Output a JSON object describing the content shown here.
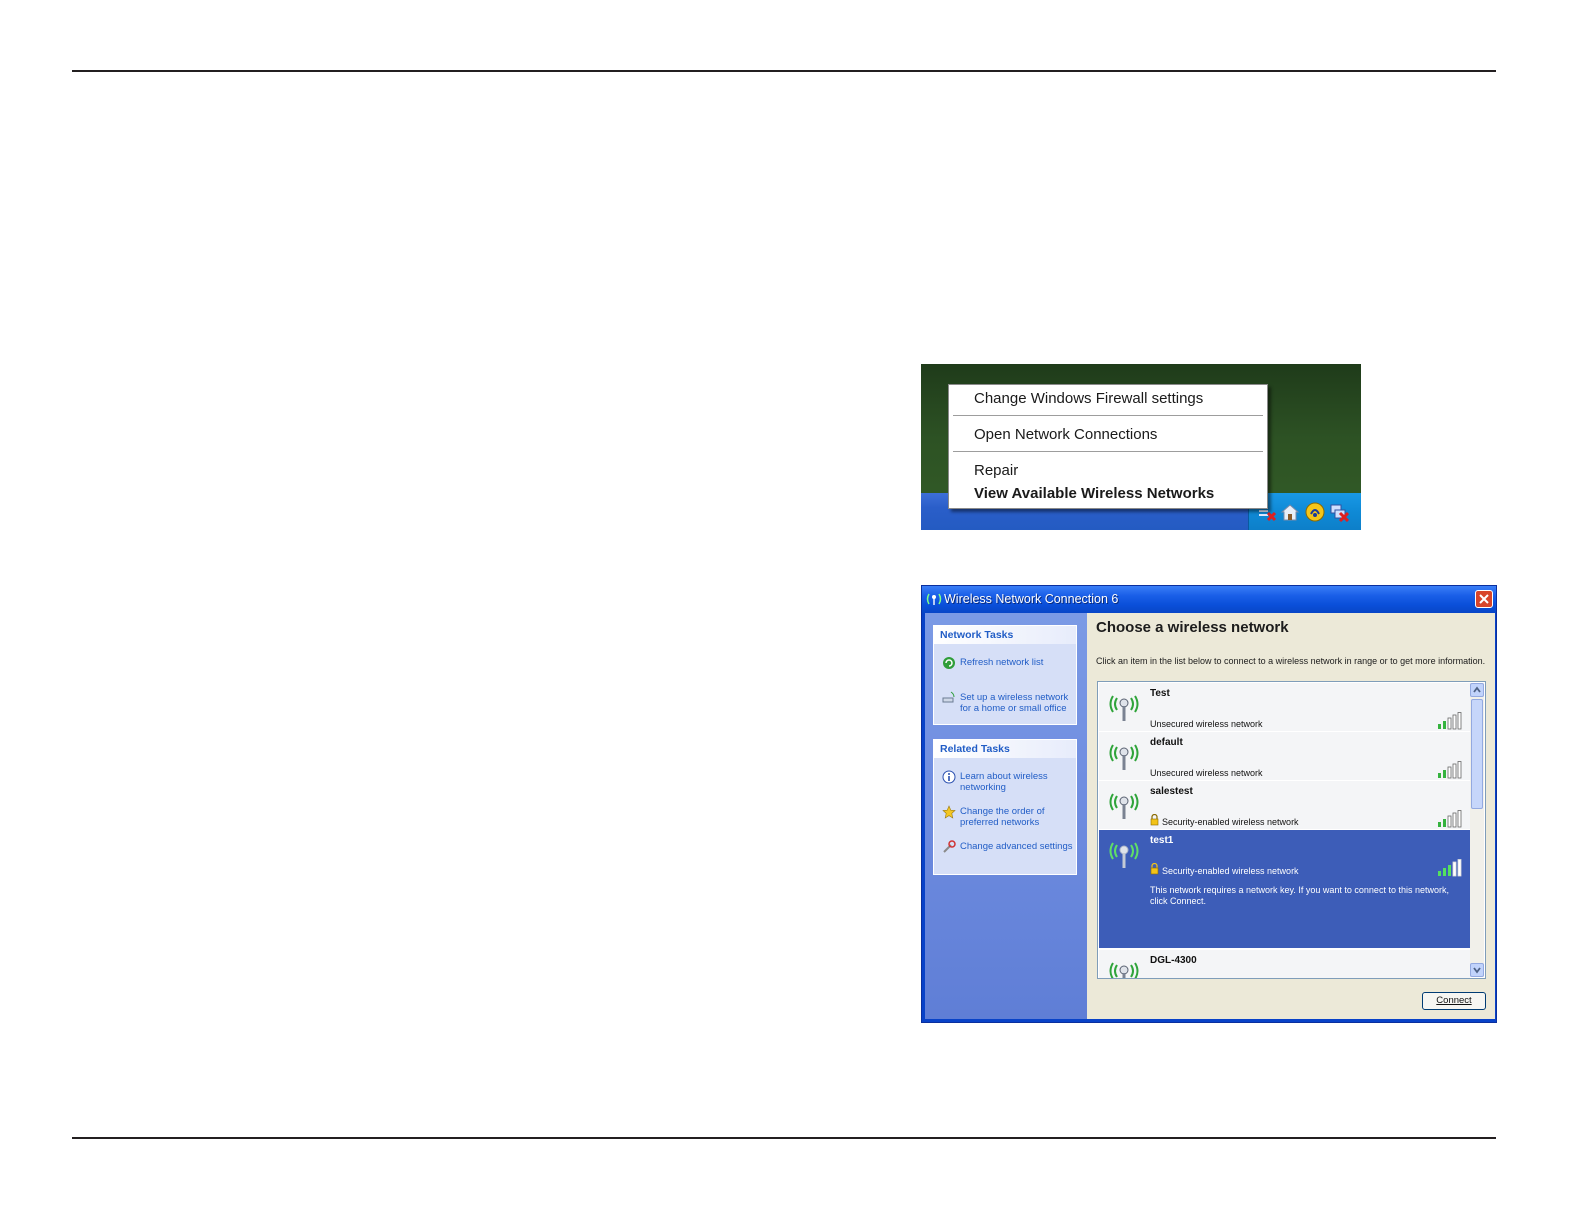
{
  "context_menu": {
    "items": [
      {
        "label": "Change Windows Firewall settings",
        "bold": false
      },
      {
        "label": "Open Network Connections",
        "bold": false
      },
      {
        "label": "Repair",
        "bold": false
      },
      {
        "label": "View Available Wireless Networks",
        "bold": true
      }
    ],
    "tray_icons": [
      "wireless-disconnected-icon",
      "home-network-icon",
      "security-alert-icon",
      "network-disconnected-icon"
    ]
  },
  "dialog": {
    "title": "Wireless Network Connection 6",
    "heading": "Choose a wireless network",
    "instruction": "Click an item in the list below to connect to a wireless network in range or to get more information.",
    "network_tasks": {
      "header": "Network Tasks",
      "items": [
        {
          "label": "Refresh network list",
          "icon": "refresh-icon"
        },
        {
          "label": "Set up a wireless network for a home or small office",
          "icon": "wireless-setup-icon"
        }
      ]
    },
    "related_tasks": {
      "header": "Related Tasks",
      "items": [
        {
          "label": "Learn about wireless networking",
          "icon": "info-icon"
        },
        {
          "label": "Change the order of preferred networks",
          "icon": "star-icon"
        },
        {
          "label": "Change advanced settings",
          "icon": "settings-icon"
        }
      ]
    },
    "networks": [
      {
        "name": "Test",
        "status": "Unsecured wireless network",
        "secured": false,
        "selected": false
      },
      {
        "name": "default",
        "status": "Unsecured wireless network",
        "secured": false,
        "selected": false
      },
      {
        "name": "salestest",
        "status": "Security-enabled wireless network",
        "secured": true,
        "selected": false
      },
      {
        "name": "test1",
        "status": "Security-enabled wireless network",
        "secured": true,
        "selected": true,
        "note": "This network requires a network key. If you want to connect to this network, click Connect."
      },
      {
        "name": "DGL-4300",
        "status": "",
        "secured": false,
        "selected": false
      }
    ],
    "connect_label": "Connect"
  }
}
